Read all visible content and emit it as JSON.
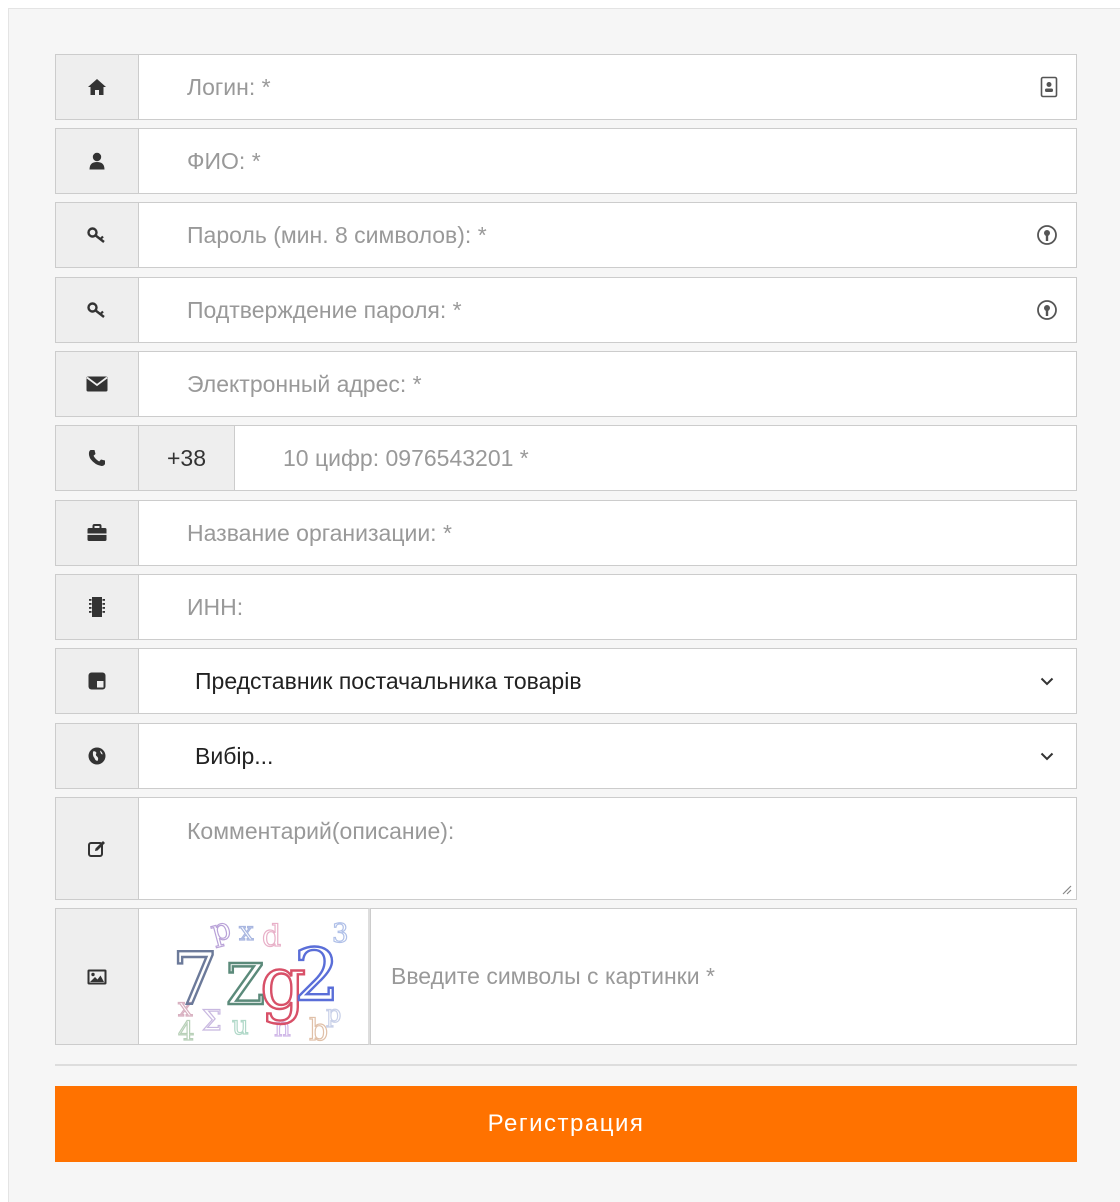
{
  "form": {
    "fields": {
      "login": {
        "placeholder": "Логин: *",
        "icon": "home-icon",
        "trailing_icon": "autofill-contact-icon"
      },
      "full_name": {
        "placeholder": "ФИО: *",
        "icon": "user-icon"
      },
      "password": {
        "placeholder": "Пароль (мин. 8 символов): *",
        "icon": "key-icon",
        "trailing_icon": "password-key-icon"
      },
      "password_confirm": {
        "placeholder": "Подтверждение пароля: *",
        "icon": "key-icon",
        "trailing_icon": "password-key-icon"
      },
      "email": {
        "placeholder": "Электронный адрес: *",
        "icon": "envelope-icon"
      },
      "phone": {
        "prefix": "+38",
        "placeholder": "10 цифр: 0976543201 *",
        "icon": "phone-icon"
      },
      "organization": {
        "placeholder": "Название организации: *",
        "icon": "briefcase-icon"
      },
      "inn": {
        "placeholder": "ИНН:",
        "icon": "chip-icon"
      },
      "role": {
        "selected": "Представник постачальника товарів",
        "icon": "checker-icon"
      },
      "region": {
        "selected": "Вибір...",
        "icon": "globe-icon"
      },
      "comment": {
        "placeholder": "Комментарий(описание):",
        "icon": "edit-icon"
      },
      "captcha": {
        "placeholder": "Введите символы с картинки *",
        "icon": "image-icon",
        "code": "7Zg2"
      }
    },
    "submit_label": "Регистрация"
  },
  "colors": {
    "accent": "#ff7200",
    "addon_bg": "#eeeeee",
    "border": "#cccccc",
    "placeholder": "#999999",
    "page_bg": "#f6f6f6"
  }
}
